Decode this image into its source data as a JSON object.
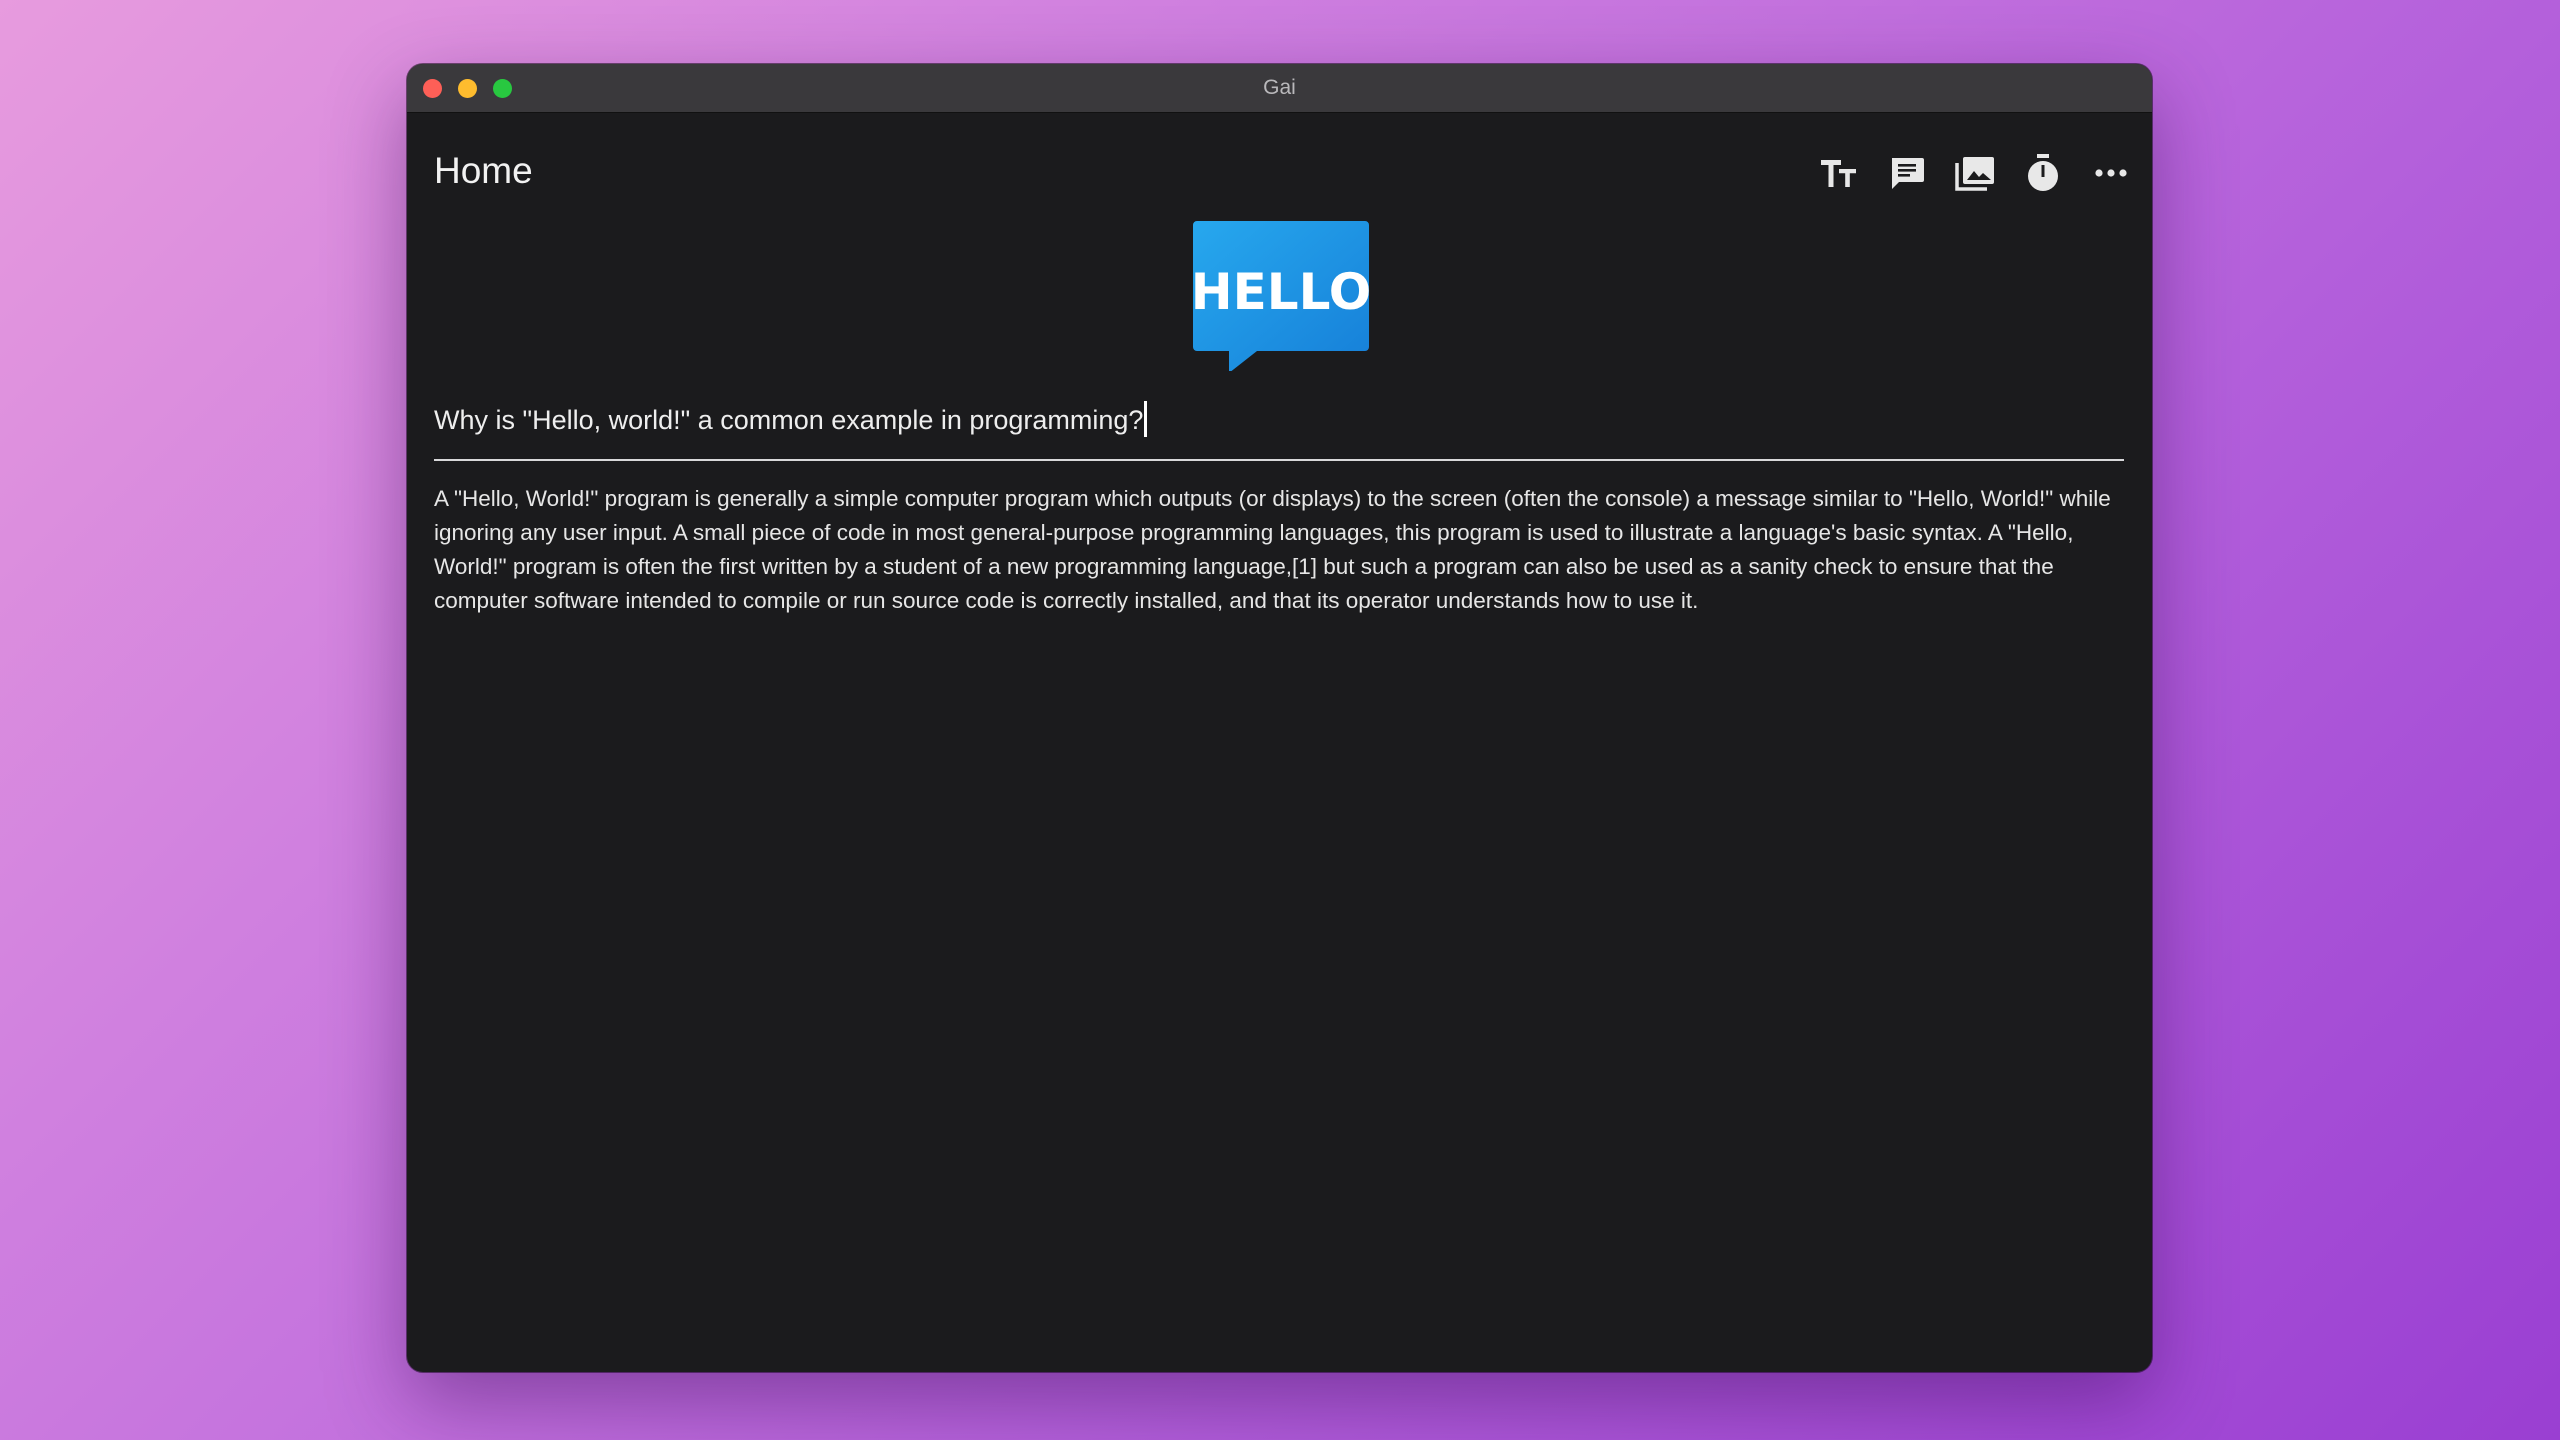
{
  "window": {
    "title": "Gai"
  },
  "header": {
    "title": "Home",
    "tools": [
      {
        "icon": "text-size-icon"
      },
      {
        "icon": "chat-icon"
      },
      {
        "icon": "image-icon"
      },
      {
        "icon": "timer-icon"
      },
      {
        "icon": "more-icon"
      }
    ]
  },
  "logo": {
    "text": "HELLO",
    "color": "#1f93e6"
  },
  "prompt": {
    "value": "Why is \"Hello, world!\" a common example in programming?"
  },
  "response": {
    "text": "A \"Hello, World!\" program is generally a simple computer program which outputs (or displays) to the screen (often the console) a message similar to \"Hello, World!\" while ignoring any user input. A small piece of code in most general-purpose programming languages, this program is used to illustrate a language's basic syntax. A \"Hello, World!\" program is often the first written by a student of a new programming language,[1] but such a program can also be used as a sanity check to ensure that the computer software intended to compile or run source code is correctly installed, and that its operator understands how to use it."
  },
  "colors": {
    "background_gradient_start": "#e79bde",
    "background_gradient_end": "#9a3fd2",
    "window_bg": "#1b1b1d",
    "titlebar_bg": "#3a393c",
    "close": "#fe5f57",
    "minimize": "#febc2e",
    "maximize": "#28c840"
  }
}
